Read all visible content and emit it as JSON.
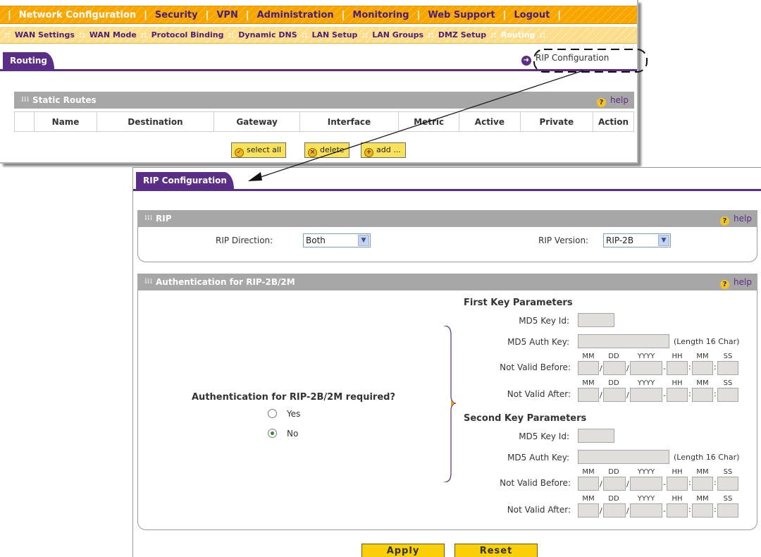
{
  "top_nav": {
    "items": [
      {
        "label": "Network Configuration"
      },
      {
        "label": "Security"
      },
      {
        "label": "VPN"
      },
      {
        "label": "Administration"
      },
      {
        "label": "Monitoring"
      },
      {
        "label": "Web Support"
      },
      {
        "label": "Logout"
      }
    ]
  },
  "sub_nav": {
    "items": [
      {
        "label": "WAN Settings"
      },
      {
        "label": "WAN Mode"
      },
      {
        "label": "Protocol Binding"
      },
      {
        "label": "Dynamic DNS"
      },
      {
        "label": "LAN Setup"
      },
      {
        "label": "LAN Groups"
      },
      {
        "label": "DMZ Setup"
      },
      {
        "label": "Routing"
      }
    ]
  },
  "routing": {
    "tab_label": "Routing",
    "rip_link": "RIP Configuration",
    "static_routes": {
      "title": "Static Routes",
      "help": "help",
      "columns": [
        "",
        "Name",
        "Destination",
        "Gateway",
        "Interface",
        "Metric",
        "Active",
        "Private",
        "Action"
      ]
    },
    "buttons": {
      "select_all": "select all",
      "delete": "delete",
      "add": "add ..."
    }
  },
  "rip_config": {
    "tab_label": "RIP Configuration",
    "rip_section": {
      "title": "RIP",
      "help": "help",
      "direction_label": "RIP Direction:",
      "direction_value": "Both",
      "version_label": "RIP Version:",
      "version_value": "RIP-2B"
    },
    "auth_section": {
      "title": "Authentication for RIP-2B/2M",
      "help": "help",
      "question": "Authentication for RIP-2B/2M required?",
      "options": {
        "yes": "Yes",
        "no": "No"
      },
      "selected": "No",
      "first_key": {
        "heading": "First Key Parameters",
        "md5_key_id_label": "MD5 Key Id:",
        "md5_auth_key_label": "MD5 Auth Key:",
        "length_hint": "(Length 16 Char)",
        "not_valid_before_label": "Not Valid Before:",
        "not_valid_after_label": "Not Valid After:"
      },
      "second_key": {
        "heading": "Second Key Parameters",
        "md5_key_id_label": "MD5 Key Id:",
        "md5_auth_key_label": "MD5 Auth Key:",
        "length_hint": "(Length 16 Char)",
        "not_valid_before_label": "Not Valid Before:",
        "not_valid_after_label": "Not Valid After:"
      },
      "date_headers": {
        "mm": "MM",
        "dd": "DD",
        "yyyy": "YYYY",
        "hh": "HH",
        "min": "MM",
        "ss": "SS"
      }
    },
    "buttons": {
      "apply": "Apply",
      "reset": "Reset"
    }
  }
}
